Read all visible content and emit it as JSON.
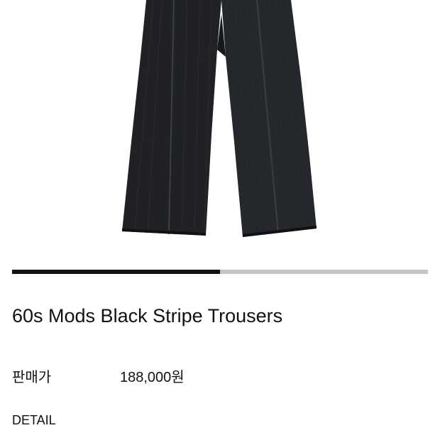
{
  "product": {
    "image_name": "black-stripe-trousers-photo",
    "title": "60s Mods Black Stripe Trousers",
    "price_label": "판매가",
    "price_value": "188,000원"
  },
  "gallery": {
    "progress_fraction": 0.5
  },
  "detail": {
    "label": "DETAIL"
  },
  "colors": {
    "trouser": "#1f2124",
    "progress_active": "#111111",
    "progress_track": "#c4c4c4"
  }
}
